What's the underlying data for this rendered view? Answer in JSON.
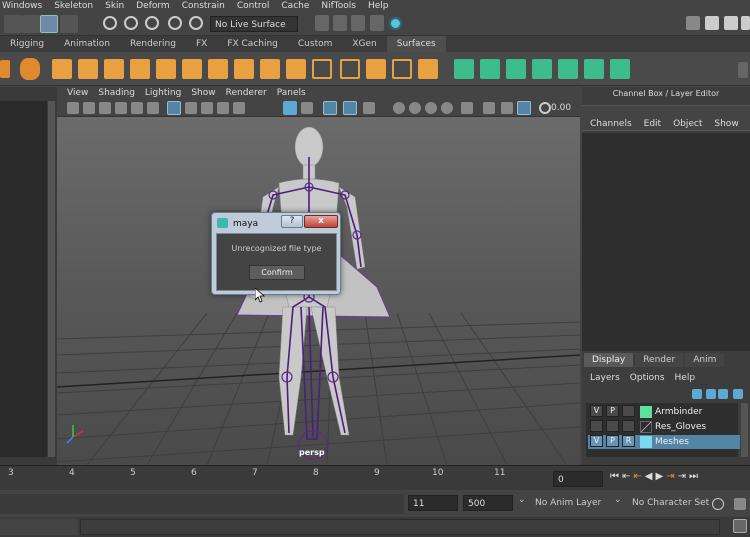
{
  "menubar": [
    "Windows",
    "Skeleton",
    "Skin",
    "Deform",
    "Constrain",
    "Control",
    "Cache",
    "NifTools",
    "Help"
  ],
  "status": {
    "live_surface": "No Live Surface"
  },
  "shelf_tabs": [
    "Rigging",
    "Animation",
    "Rendering",
    "FX",
    "FX Caching",
    "Custom",
    "XGen",
    "Surfaces"
  ],
  "viewport": {
    "menu": [
      "View",
      "Shading",
      "Lighting",
      "Show",
      "Renderer",
      "Panels"
    ],
    "gamma_value": "0.00",
    "camera_label": "persp"
  },
  "channel_box": {
    "title": "Channel Box / Layer Editor",
    "menu": [
      "Channels",
      "Edit",
      "Object",
      "Show"
    ]
  },
  "layer_editor": {
    "tabs": [
      "Display",
      "Render",
      "Anim"
    ],
    "menu": [
      "Layers",
      "Options",
      "Help"
    ],
    "layers": [
      {
        "v": "V",
        "p": "P",
        "r": "",
        "name": "Armbinder",
        "color": "#5ce0a0"
      },
      {
        "v": "",
        "p": "",
        "r": "",
        "name": "Res_Gloves",
        "color": ""
      },
      {
        "v": "V",
        "p": "P",
        "r": "R",
        "name": "Meshes",
        "color": "#7ad8ef"
      }
    ]
  },
  "timeline": {
    "ticks": [
      "3",
      "4",
      "5",
      "6",
      "7",
      "8",
      "9",
      "10",
      "11"
    ],
    "current_frame": "0"
  },
  "range": {
    "end_frame": "11",
    "max_frame": "500",
    "anim_layer": "No Anim Layer",
    "character_set": "No Character Set"
  },
  "dialog": {
    "title": "maya",
    "message": "Unrecognized file type",
    "confirm_label": "Confirm",
    "help_label": "?",
    "close_label": "x"
  },
  "colors": {
    "accent": "#5da9d6",
    "selected_layer": "#5285a6"
  }
}
